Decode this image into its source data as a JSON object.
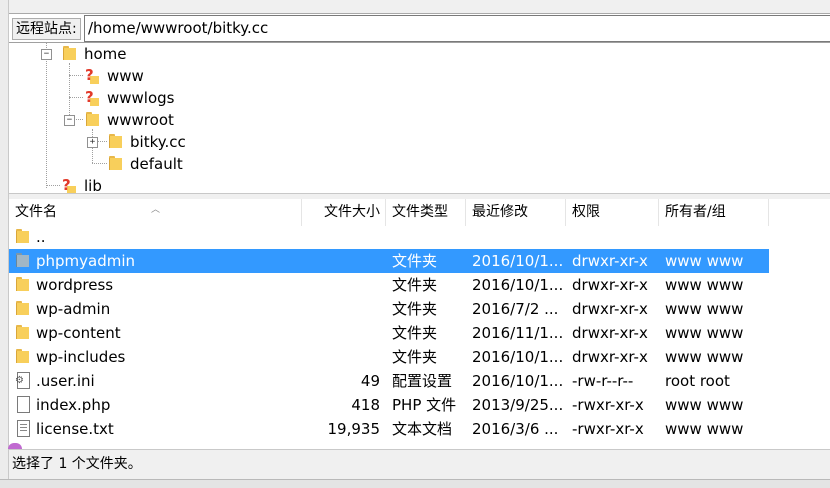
{
  "address_bar": {
    "label": "远程站点:",
    "path": "/home/wwwroot/bitky.cc"
  },
  "tree": {
    "nodes": [
      {
        "label": "home",
        "icon": "folder-icon"
      },
      {
        "label": "www",
        "icon": "folder-question-icon"
      },
      {
        "label": "wwwlogs",
        "icon": "folder-question-icon"
      },
      {
        "label": "wwwroot",
        "icon": "folder-icon"
      },
      {
        "label": "bitky.cc",
        "icon": "folder-icon"
      },
      {
        "label": "default",
        "icon": "folder-icon"
      },
      {
        "label": "lib",
        "icon": "folder-question-icon"
      }
    ]
  },
  "file_list": {
    "columns": [
      "文件名",
      "文件大小",
      "文件类型",
      "最近修改",
      "权限",
      "所有者/组"
    ],
    "rows": [
      {
        "name": "..",
        "size": "",
        "type": "",
        "modified": "",
        "perms": "",
        "owner": "",
        "icon": "folder-icon"
      },
      {
        "name": "phpmyadmin",
        "size": "",
        "type": "文件夹",
        "modified": "2016/10/1...",
        "perms": "drwxr-xr-x",
        "owner": "www www",
        "icon": "folder-icon",
        "selected": true
      },
      {
        "name": "wordpress",
        "size": "",
        "type": "文件夹",
        "modified": "2016/10/1...",
        "perms": "drwxr-xr-x",
        "owner": "www www",
        "icon": "folder-icon"
      },
      {
        "name": "wp-admin",
        "size": "",
        "type": "文件夹",
        "modified": "2016/7/2 ...",
        "perms": "drwxr-xr-x",
        "owner": "www www",
        "icon": "folder-icon"
      },
      {
        "name": "wp-content",
        "size": "",
        "type": "文件夹",
        "modified": "2016/11/1...",
        "perms": "drwxr-xr-x",
        "owner": "www www",
        "icon": "folder-icon"
      },
      {
        "name": "wp-includes",
        "size": "",
        "type": "文件夹",
        "modified": "2016/10/1...",
        "perms": "drwxr-xr-x",
        "owner": "www www",
        "icon": "folder-icon"
      },
      {
        "name": ".user.ini",
        "size": "49",
        "type": "配置设置",
        "modified": "2016/10/1...",
        "perms": "-rw-r--r--",
        "owner": "root root",
        "icon": "config-file-icon"
      },
      {
        "name": "index.php",
        "size": "418",
        "type": "PHP 文件",
        "modified": "2013/9/25...",
        "perms": "-rwxr-xr-x",
        "owner": "www www",
        "icon": "file-icon"
      },
      {
        "name": "license.txt",
        "size": "19,935",
        "type": "文本文档",
        "modified": "2016/3/6 ...",
        "perms": "-rwxr-xr-x",
        "owner": "www www",
        "icon": "text-file-icon"
      }
    ]
  },
  "status_bar": {
    "text": "选择了 1 个文件夹。"
  },
  "colors": {
    "selection": "#3399ff",
    "folder": "#f8cf5b",
    "question_mark": "#e23a2a"
  }
}
